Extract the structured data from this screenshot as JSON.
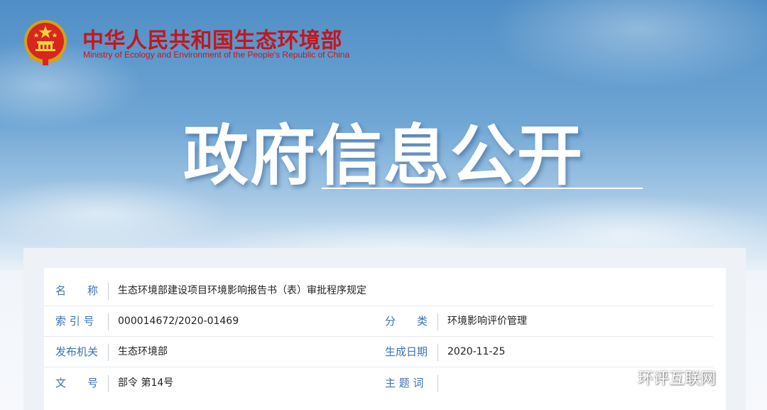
{
  "header": {
    "ministry_cn": "中华人民共和国生态环境部",
    "ministry_en": "Ministry of Ecology and Environment of the People's Republic of China",
    "emblem_icon": "national-emblem-icon"
  },
  "banner": {
    "title": "政府信息公开"
  },
  "info": {
    "name_label": "名　　称",
    "name_value": "生态环境部建设项目环境影响报告书（表）审批程序规定",
    "index_label": "索 引 号",
    "index_value": "000014672/2020-01469",
    "category_label": "分　　类",
    "category_value": "环境影响评价管理",
    "issuer_label": "发布机关",
    "issuer_value": "生态环境部",
    "date_label": "生成日期",
    "date_value": "2020-11-25",
    "doc_no_label": "文　　号",
    "doc_no_value": "部令 第14号",
    "keywords_label": "主 题 词",
    "keywords_value": ""
  },
  "watermark": {
    "text": "环评互联网",
    "icon": "wechat-icon"
  },
  "colors": {
    "ministry_red": "#c4161c",
    "label_blue": "#3a71b7"
  }
}
